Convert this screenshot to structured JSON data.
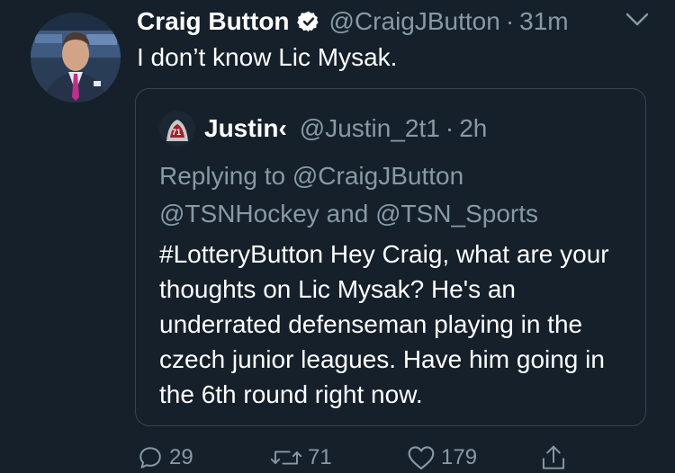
{
  "tweet": {
    "display_name": "Craig Button",
    "handle": "@CraigJButton",
    "separator": "·",
    "time": "31m",
    "text": "I don’t know Lic Mysak.",
    "verified": true,
    "avatar_icon": "profile-photo",
    "menu_icon": "chevron-down-icon"
  },
  "quoted": {
    "display_name": "Justin‹",
    "handle": "@Justin_2t1",
    "separator": "·",
    "time": "2h",
    "replying_prefix": "Replying to ",
    "reply_to_1": "@CraigJButton",
    "reply_to_2": "@TSNHockey",
    "reply_and": " and ",
    "reply_to_3": "@TSN_Sports",
    "text": "#LotteryButton Hey Craig, what are your thoughts on Lic Mysak? He's an underrated defenseman playing in the czech junior leagues. Have him going in the 6th round right now."
  },
  "actions": {
    "reply_count": "29",
    "retweet_count": "71",
    "like_count": "179"
  },
  "colors": {
    "background": "#15202b",
    "secondary_text": "#8899a6",
    "border": "#38444d",
    "verified_badge": "#ffffff"
  }
}
